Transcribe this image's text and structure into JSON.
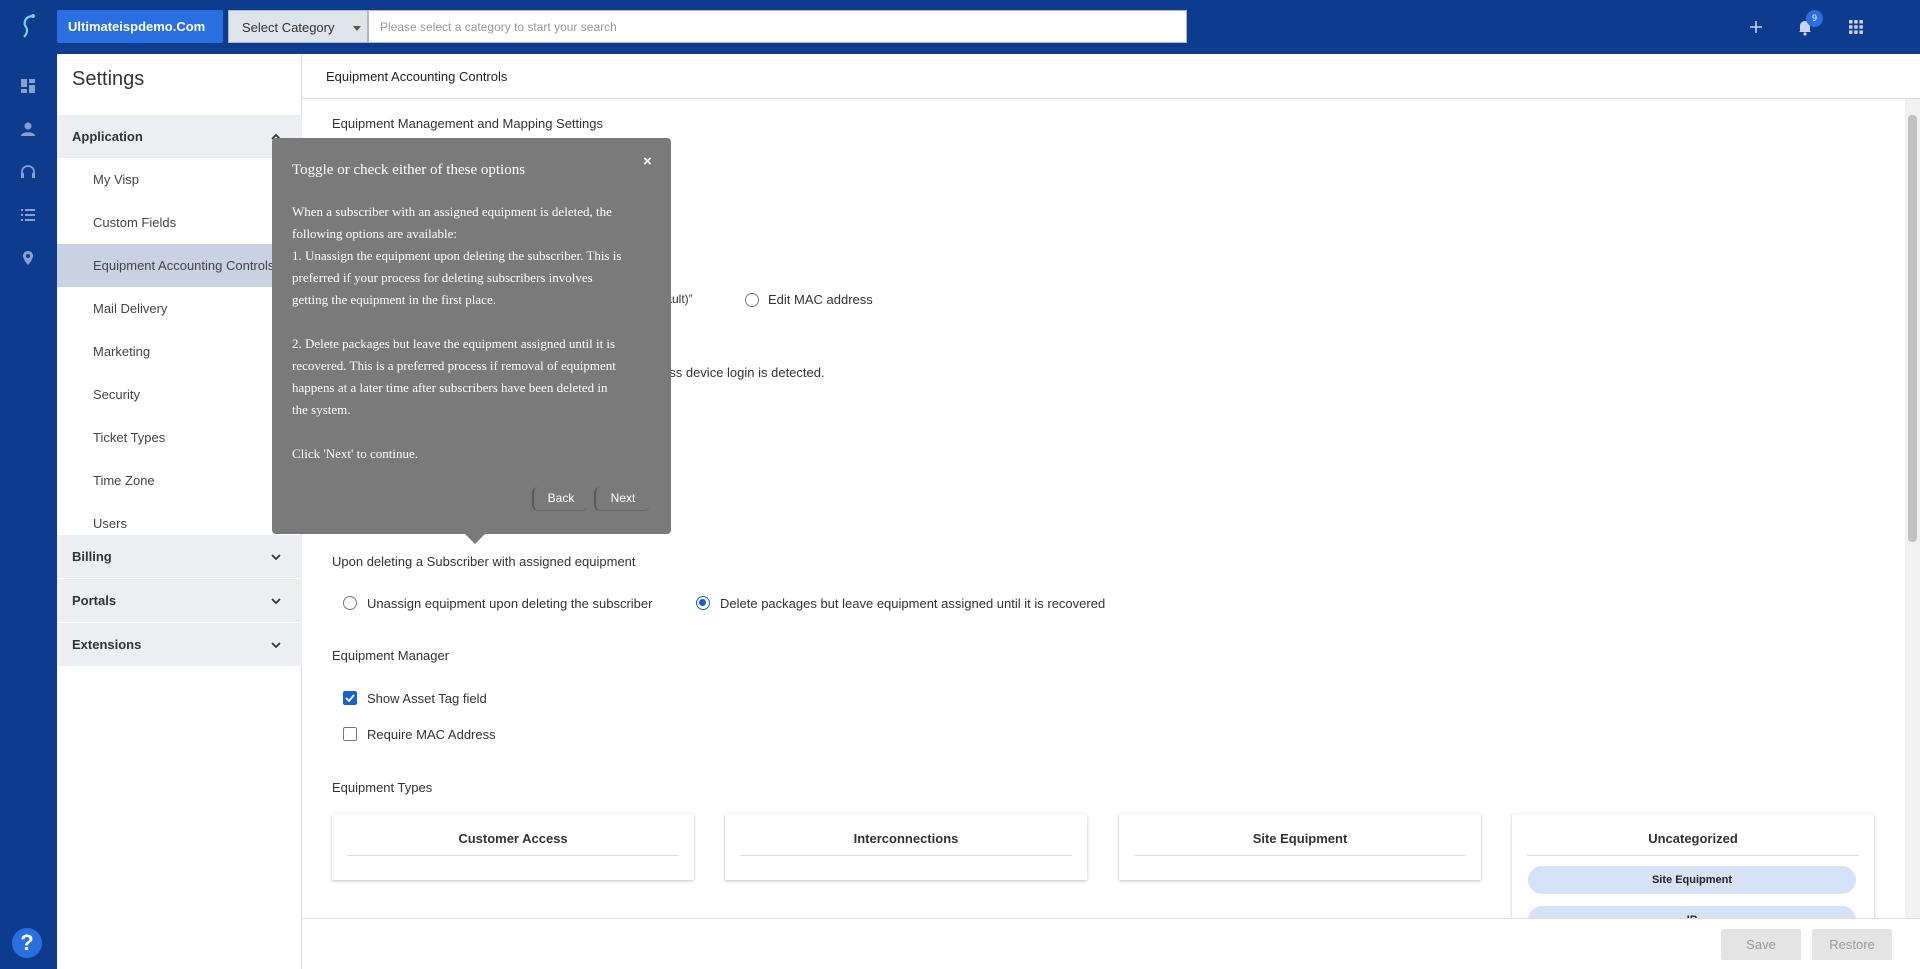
{
  "header": {
    "brand": "Ultimateispdemo.Com",
    "category_select": "Select Category",
    "search_placeholder": "Please select a category to start your search",
    "notification_count": "9"
  },
  "rail": {
    "help": "?"
  },
  "sidebar": {
    "title": "Settings",
    "sections": [
      {
        "label": "Application",
        "expanded": true
      },
      {
        "label": "Billing"
      },
      {
        "label": "Portals"
      },
      {
        "label": "Extensions"
      }
    ],
    "items": [
      {
        "label": "My Visp"
      },
      {
        "label": "Custom Fields"
      },
      {
        "label": "Equipment Accounting Controls",
        "active": true
      },
      {
        "label": "Mail Delivery"
      },
      {
        "label": "Marketing"
      },
      {
        "label": "Security"
      },
      {
        "label": "Ticket Types"
      },
      {
        "label": "Time Zone"
      },
      {
        "label": "Users"
      }
    ]
  },
  "main": {
    "title": "Equipment Accounting Controls",
    "mapping_heading": "Equipment Management and Mapping Settings",
    "partial_default": "fault)”",
    "edit_mac": "Edit MAC address",
    "partial_device_login": "ess device login is detected.",
    "delete_heading": "Upon deleting a Subscriber with assigned equipment",
    "delete_options": [
      {
        "label": "Unassign equipment upon deleting the subscriber",
        "selected": false
      },
      {
        "label": "Delete packages but leave equipment assigned until it is recovered",
        "selected": true
      }
    ],
    "manager_heading": "Equipment Manager",
    "manager_options": [
      {
        "label": "Show Asset Tag field",
        "checked": true
      },
      {
        "label": "Require MAC Address",
        "checked": false
      }
    ],
    "types_heading": "Equipment Types",
    "types": [
      "Customer Access",
      "Interconnections",
      "Site Equipment",
      "Uncategorized"
    ],
    "uncategorized_items": [
      "Site Equipment",
      "IP"
    ]
  },
  "footer": {
    "save": "Save",
    "restore": "Restore"
  },
  "tooltip": {
    "title": "Toggle or check either of these options",
    "close": "×",
    "lines": [
      "When a subscriber with an assigned equipment is deleted, the",
      "following options are available:",
      "1. Unassign the equipment upon deleting the subscriber. This is",
      "preferred if your process for deleting subscribers involves",
      "getting the equipment in the first place.",
      "2. Delete packages but leave the equipment assigned until it is",
      "recovered. This is a preferred process if removal of equipment",
      "happens at a later time after subscribers have been deleted in",
      "the system.",
      "Click 'Next' to continue."
    ],
    "back": "Back",
    "next": "Next"
  },
  "colors": {
    "topbar": "#0d3b8e",
    "brand": "#2a6fe0",
    "accent": "#1a5fd0",
    "tooltip": "#7a7a7a"
  }
}
